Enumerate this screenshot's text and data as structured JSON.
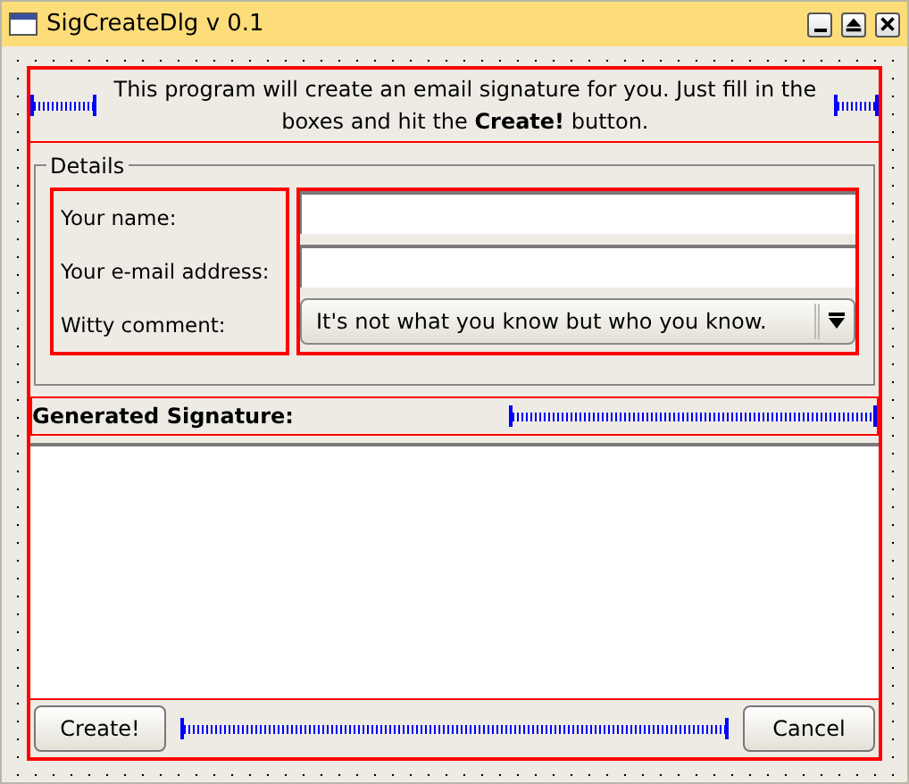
{
  "window": {
    "title": "SigCreateDlg v 0.1"
  },
  "intro": "This program will create an email signature for you. Just fill in the boxes and hit the **Create!** button.",
  "details": {
    "title": "Details",
    "fields": [
      {
        "kind": "text",
        "label": "Your name:"
      },
      {
        "kind": "text",
        "label": "Your e-mail address:"
      },
      {
        "kind": "combo",
        "label": "Witty comment:",
        "value": "It's not what you know but who you know."
      }
    ]
  },
  "signature": {
    "label": "Generated Signature:"
  },
  "buttons": [
    {
      "label": "Create!"
    },
    {
      "label": "Cancel"
    }
  ]
}
